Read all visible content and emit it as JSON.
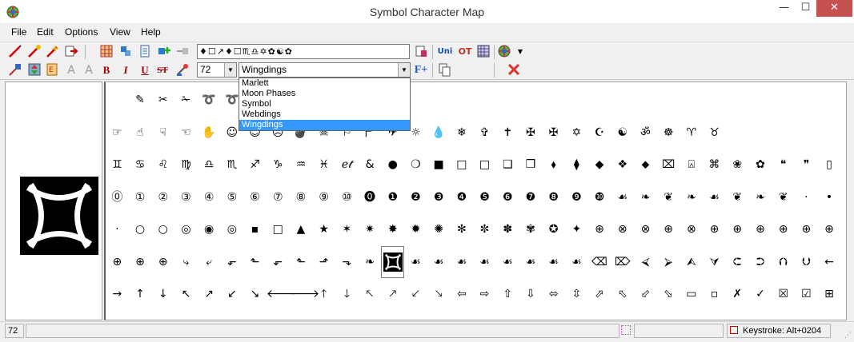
{
  "window": {
    "title": "Symbol Character Map",
    "minimize_glyph": "—",
    "maximize_glyph": "☐",
    "close_glyph": "✕"
  },
  "menu": [
    {
      "label": "File"
    },
    {
      "label": "Edit"
    },
    {
      "label": "Options"
    },
    {
      "label": "View"
    },
    {
      "label": "Help"
    }
  ],
  "toolbar": {
    "symbols_buffer": "♦☐↗♦☐♏♎✡✿☯✿",
    "font_size_value": "72",
    "font_value": "Wingdings",
    "font_options": [
      "Marlett",
      "Moon Phases",
      "Symbol",
      "Webdings",
      "Wingdings"
    ],
    "selected_font_index": 4,
    "bold_label": "B",
    "italic_label": "I",
    "underline_label": "U",
    "strike_label": "ST",
    "unicode_label": "Uni",
    "ot_label": "OT",
    "add_font_label": "F+"
  },
  "grid_rows": [
    [
      "",
      "✎",
      "✂",
      "✁",
      "➰",
      "➰",
      "",
      "",
      "",
      "",
      "",
      "",
      "",
      "",
      "",
      "",
      "",
      "",
      "",
      "",
      "",
      "",
      "",
      "",
      "",
      "",
      "",
      "",
      "",
      "",
      "",
      "",
      ""
    ],
    [
      "☞",
      "☝",
      "☟",
      "☜",
      "✋",
      "☺",
      "☺",
      "☹",
      "💣",
      "☠",
      "⚐",
      "🏱",
      "✈",
      "☼",
      "💧",
      "❄",
      "✞",
      "✝",
      "✠",
      "✠",
      "✡",
      "☪",
      "☯",
      "ॐ",
      "☸",
      "♈",
      "♉",
      "",
      "",
      "",
      "",
      "",
      ""
    ],
    [
      "♊",
      "♋",
      "♌",
      "♍",
      "♎",
      "♏",
      "♐",
      "♑",
      "♒",
      "♓",
      "ℯ𝓉",
      "&",
      "●",
      "❍",
      "■",
      "□",
      "□",
      "❑",
      "❒",
      "⬧",
      "⧫",
      "◆",
      "❖",
      "⬥",
      "⌧",
      "⍓",
      "⌘",
      "❀",
      "✿",
      "❝",
      "❞",
      "▯",
      ""
    ],
    [
      "⓪",
      "①",
      "②",
      "③",
      "④",
      "⑤",
      "⑥",
      "⑦",
      "⑧",
      "⑨",
      "⑩",
      "⓿",
      "❶",
      "❷",
      "❸",
      "❹",
      "❺",
      "❻",
      "❼",
      "❽",
      "❾",
      "❿",
      "☙",
      "❧",
      "❦",
      "❧",
      "☙",
      "❦",
      "❧",
      "❦",
      "·",
      "•",
      ""
    ],
    [
      "·",
      "○",
      "○",
      "◎",
      "◉",
      "◎",
      "▪",
      "□",
      "▲",
      "★",
      "✶",
      "✷",
      "✸",
      "✹",
      "✺",
      "✻",
      "✼",
      "✽",
      "✾",
      "✪",
      "✦",
      "⊕",
      "⊗",
      "⊗",
      "⊕",
      "⊗",
      "⊕",
      "⊕",
      "⊕",
      "⊕",
      "⊕",
      "⊕",
      ""
    ],
    [
      "⊕",
      "⊕",
      "⊕",
      "⤷",
      "⤶",
      "⬐",
      "⬑",
      "⬐",
      "⬑",
      "⬏",
      "⬎",
      "❧",
      "▣",
      "☙",
      "☙",
      "☙",
      "☙",
      "☙",
      "☙",
      "☙",
      "☙",
      "⌫",
      "⌦",
      "⮘",
      "⮚",
      "⮙",
      "⮛",
      "⮈",
      "⮊",
      "⮉",
      "⮋",
      "←",
      ""
    ],
    [
      "→",
      "↑",
      "↓",
      "↖",
      "↗",
      "↙",
      "↘",
      "🡐",
      "🡒",
      "🡑",
      "🡓",
      "🡔",
      "🡕",
      "🡗",
      "🡖",
      "⇦",
      "⇨",
      "⇧",
      "⇩",
      "⬄",
      "⇳",
      "⬀",
      "⬁",
      "⬃",
      "⬂",
      "▭",
      "▫",
      "✗",
      "✓",
      "☒",
      "☑",
      "⊞",
      ""
    ]
  ],
  "selected_cell": {
    "row": 5,
    "col": 12
  },
  "status": {
    "code": "72",
    "keystroke": "Keystroke: Alt+0204"
  },
  "icons": {
    "app": "app-globe-icon",
    "status_left": "pink-dotted-square-icon",
    "status_keystroke": "red-square-icon"
  }
}
